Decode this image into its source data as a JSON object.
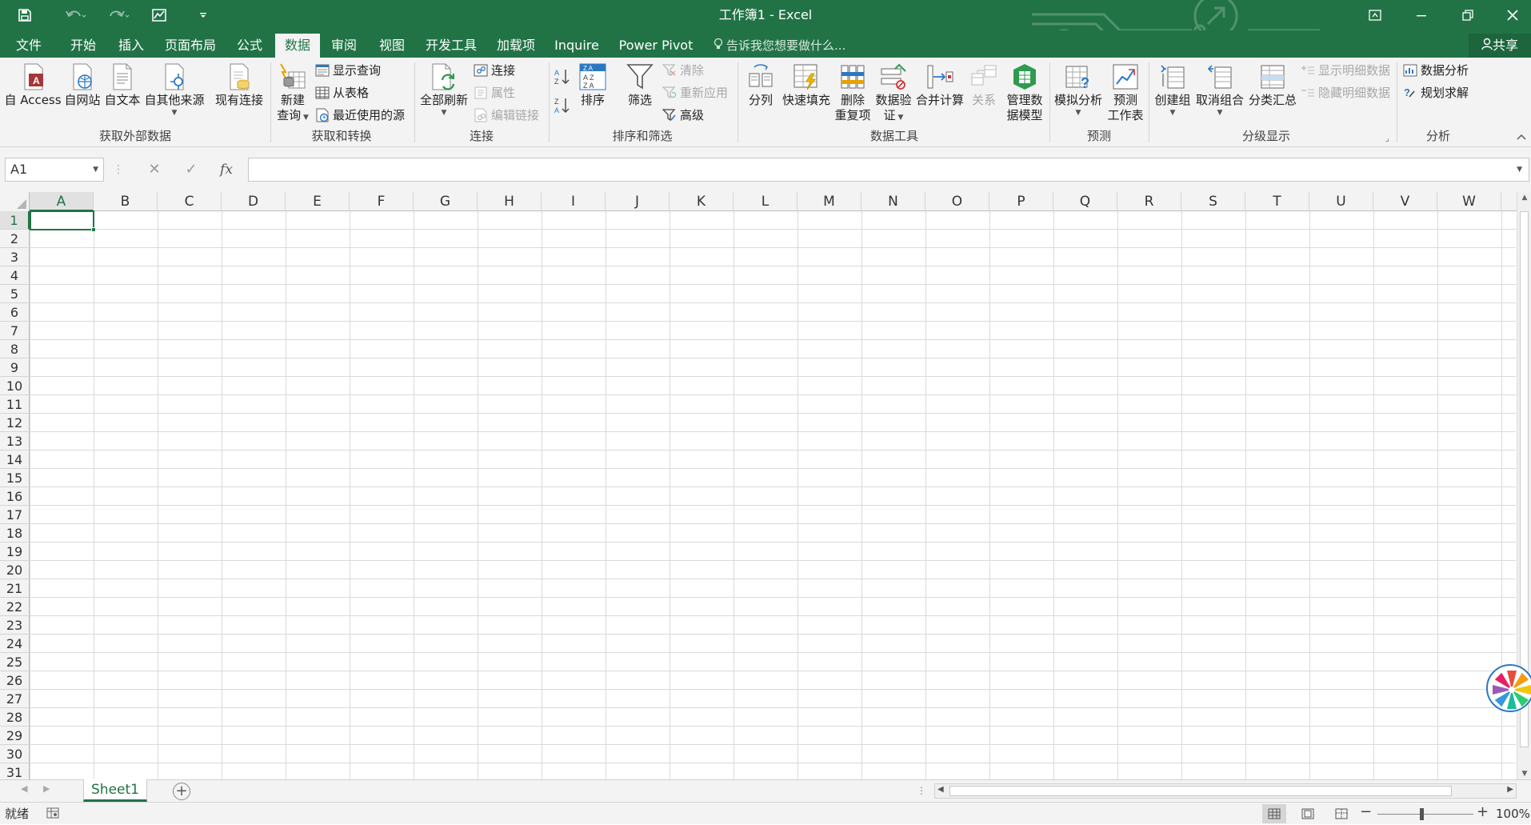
{
  "window": {
    "title": "工作簿1 - Excel"
  },
  "tabs": [
    {
      "label": "文件"
    },
    {
      "label": "开始"
    },
    {
      "label": "插入"
    },
    {
      "label": "页面布局"
    },
    {
      "label": "公式"
    },
    {
      "label": "数据"
    },
    {
      "label": "审阅"
    },
    {
      "label": "视图"
    },
    {
      "label": "开发工具"
    },
    {
      "label": "加载项"
    },
    {
      "label": "Inquire"
    },
    {
      "label": "Power Pivot"
    }
  ],
  "tell_me": {
    "placeholder": "告诉我您想要做什么..."
  },
  "share": {
    "label": "共享"
  },
  "ribbon": {
    "get_external": {
      "label": "获取外部数据",
      "from_access": "自 Access",
      "from_web": "自网站",
      "from_text": "自文本",
      "from_other": "自其他来源",
      "existing": "现有连接"
    },
    "get_transform": {
      "label": "获取和转换",
      "new_query_1": "新建",
      "new_query_2": "查询",
      "show_queries": "显示查询",
      "from_table": "从表格",
      "recent_sources": "最近使用的源"
    },
    "connections": {
      "label": "连接",
      "refresh_all": "全部刷新",
      "connections": "连接",
      "properties": "属性",
      "edit_links": "编辑链接"
    },
    "sort_filter": {
      "label": "排序和筛选",
      "sort": "排序",
      "filter": "筛选",
      "clear": "清除",
      "reapply": "重新应用",
      "advanced": "高级"
    },
    "data_tools": {
      "label": "数据工具",
      "text_to_columns": "分列",
      "flash_fill": "快速填充",
      "remove_dup_1": "删除",
      "remove_dup_2": "重复项",
      "validation_1": "数据验",
      "validation_2": "证",
      "consolidate": "合并计算",
      "relationships": "关系",
      "data_model_1": "管理数",
      "data_model_2": "据模型"
    },
    "forecast": {
      "label": "预测",
      "what_if": "模拟分析",
      "forecast_1": "预测",
      "forecast_2": "工作表"
    },
    "outline": {
      "label": "分级显示",
      "group": "创建组",
      "ungroup": "取消组合",
      "subtotal": "分类汇总",
      "show_detail": "显示明细数据",
      "hide_detail": "隐藏明细数据"
    },
    "analysis": {
      "label": "分析",
      "data_analysis": "数据分析",
      "solver": "规划求解"
    }
  },
  "formula_bar": {
    "name_box": "A1",
    "fx": "fx",
    "content": ""
  },
  "grid": {
    "columns": [
      "A",
      "B",
      "C",
      "D",
      "E",
      "F",
      "G",
      "H",
      "I",
      "J",
      "K",
      "L",
      "M",
      "N",
      "O",
      "P",
      "Q",
      "R",
      "S",
      "T",
      "U",
      "V",
      "W"
    ],
    "rows": [
      "1",
      "2",
      "3",
      "4",
      "5",
      "6",
      "7",
      "8",
      "9",
      "10",
      "11",
      "12",
      "13",
      "14",
      "15",
      "16",
      "17",
      "18",
      "19",
      "20",
      "21",
      "22",
      "23",
      "24",
      "25",
      "26",
      "27",
      "28",
      "29",
      "30",
      "31"
    ],
    "selected_cell": "A1"
  },
  "sheets": [
    {
      "label": "Sheet1"
    }
  ],
  "status": {
    "text": "就绪",
    "zoom": "100%"
  },
  "colors": {
    "accent": "#217346",
    "ribbon_bg": "#f3f3f3"
  }
}
